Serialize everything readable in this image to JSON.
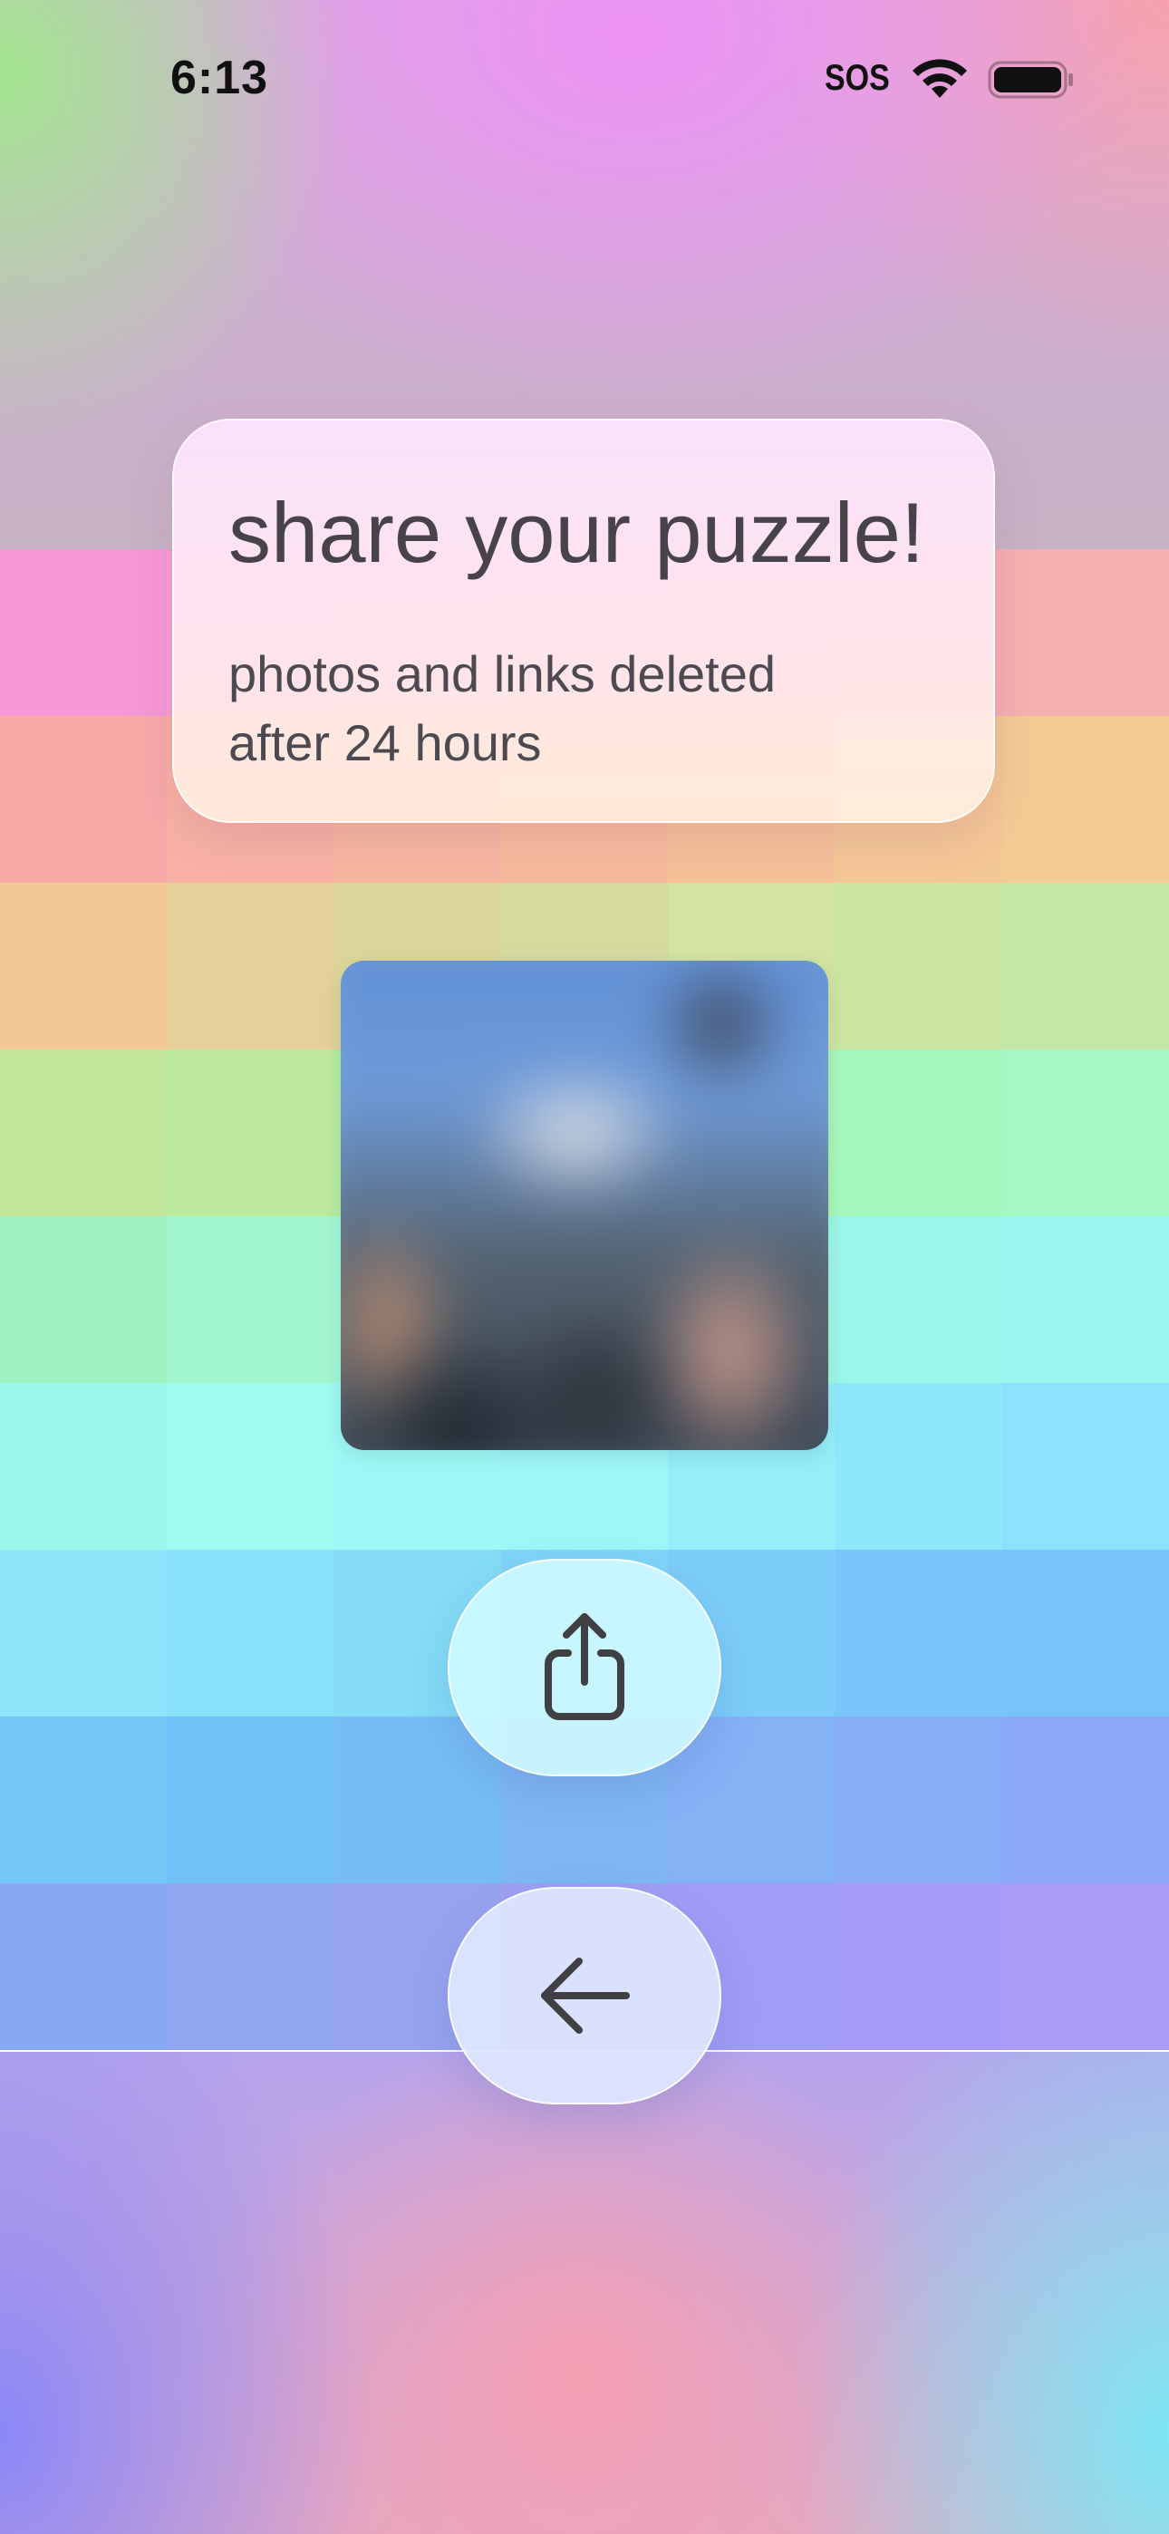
{
  "status_bar": {
    "time": "6:13",
    "sos": "SOS",
    "icons": [
      "wifi-icon",
      "battery-icon"
    ]
  },
  "card": {
    "title": "share your puzzle!",
    "subtitle": "photos and links deleted after 24 hours"
  },
  "photo": {
    "state": "blurred"
  },
  "buttons": {
    "share": {
      "icon": "share-icon"
    },
    "back": {
      "icon": "arrow-left-icon"
    }
  },
  "background": {
    "band_colors": [
      [
        "#f698d7",
        "#f79ed2",
        "#f6a5cb",
        "#f6a8c2",
        "#f7aab8",
        "#f7acb4",
        "#f7afb0"
      ],
      [
        "#f7aaa8",
        "#f8b1a4",
        "#f7b6a0",
        "#f6bb9c",
        "#f5c198",
        "#f4c796",
        "#f3cb94"
      ],
      [
        "#f2c894",
        "#e6d099",
        "#dbd79c",
        "#d7da9f",
        "#d2e3a2",
        "#cbe6a3",
        "#c5e7a5"
      ],
      [
        "#c3e79a",
        "#bdea9f",
        "#b4eda6",
        "#b0f1ad",
        "#a9f6b6",
        "#a5f8bd",
        "#a3f8c3"
      ],
      [
        "#a0f3c0",
        "#a2f6cd",
        "#a2f8d9",
        "#a4f9e1",
        "#9ff8e4",
        "#9cf7ea",
        "#9cf6ef"
      ],
      [
        "#9cf6ea",
        "#a0fbf3",
        "#9ef9f6",
        "#9ef6f8",
        "#95eefa",
        "#8de8fb",
        "#8be3fb"
      ],
      [
        "#8de4fb",
        "#87e2f9",
        "#84dcf6",
        "#81d4f7",
        "#7ccdf9",
        "#79c7fa",
        "#78c3f9"
      ],
      [
        "#74c8f7",
        "#71c2f8",
        "#76bcf6",
        "#7fb6f4",
        "#85b1f5",
        "#88acf6",
        "#8aa8f6"
      ],
      [
        "#87a9f3",
        "#8fa6f1",
        "#98a3ef",
        "#9e9ff3",
        "#a19cf6",
        "#a59af8",
        "#a89cf6"
      ]
    ]
  }
}
